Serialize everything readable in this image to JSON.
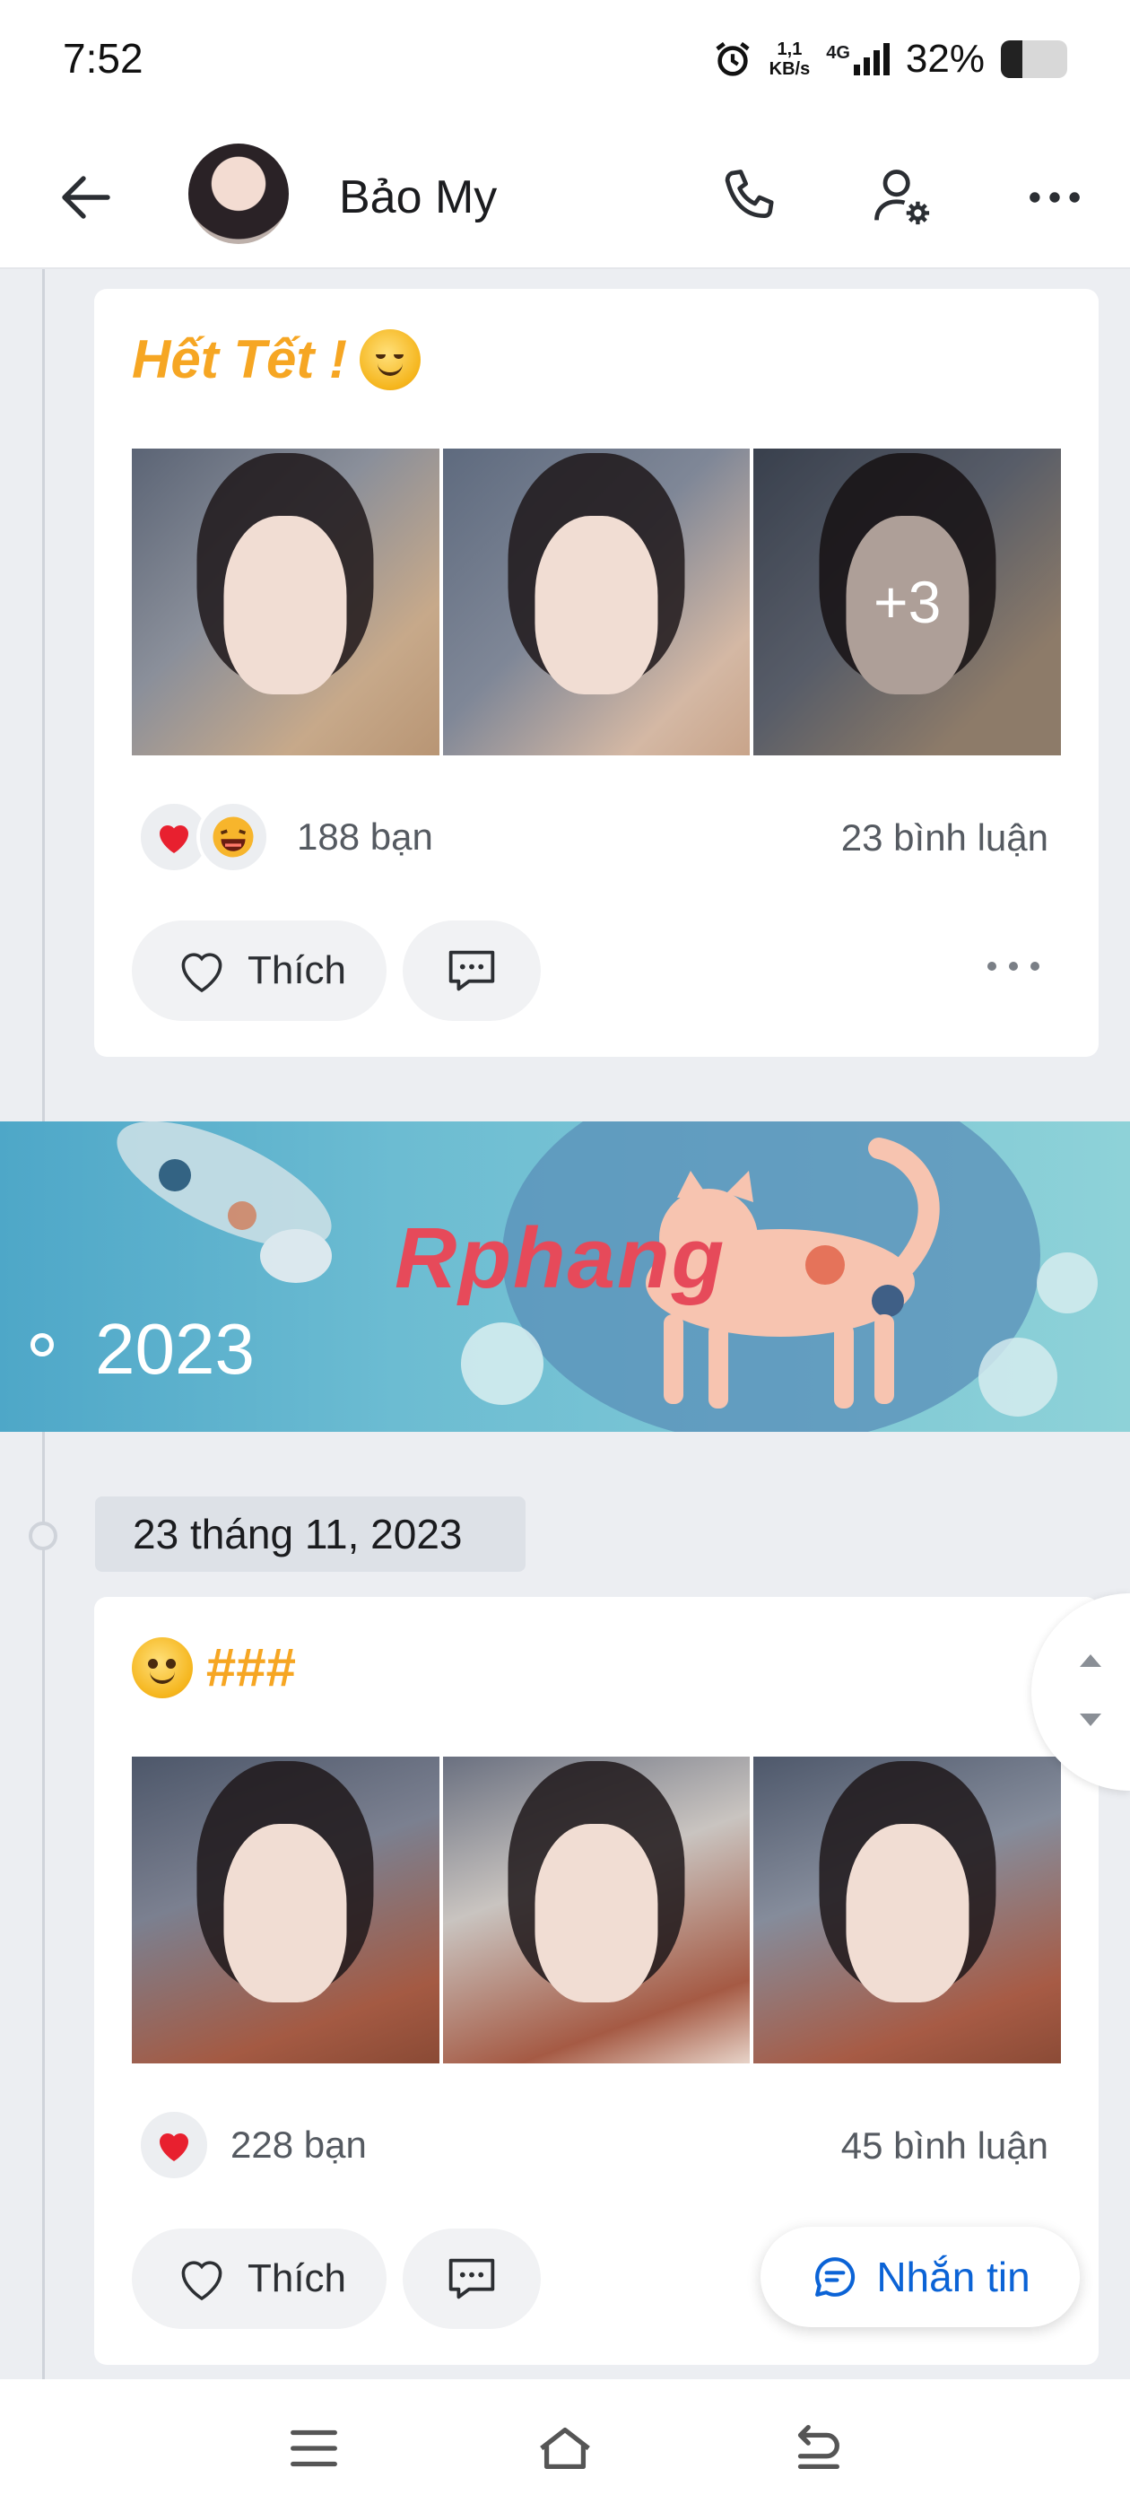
{
  "status_bar": {
    "time": "7:52",
    "net_speed_value": "1,1",
    "net_speed_unit": "KB/s",
    "network": "4G",
    "battery": "32%",
    "battery_level": 0.32
  },
  "header": {
    "name": "Bảo My",
    "icons": [
      "back-arrow-icon",
      "phone-icon",
      "user-settings-icon",
      "more-icon"
    ]
  },
  "posts": [
    {
      "title": "Hết Tết !",
      "title_emoji": "smile-emoji",
      "more_photos": "+3",
      "reaction_count": "188 bạn",
      "comment_count": "23 bình luận",
      "like_label": "Thích"
    },
    {
      "title": "###",
      "title_emoji": "grin-emoji",
      "reaction_count": "228 bạn",
      "comment_count": "45 bình luận",
      "like_label": "Thích"
    }
  ],
  "year_banner": {
    "year": "2023",
    "watermark": "Rphang"
  },
  "date_chip": "23 tháng 11, 2023",
  "fab": {
    "label": "Nhắn tin"
  },
  "colors": {
    "accent_blue": "#0b63d6",
    "title_orange": "#f6a623",
    "banner_teal": "#6cbcd2"
  }
}
